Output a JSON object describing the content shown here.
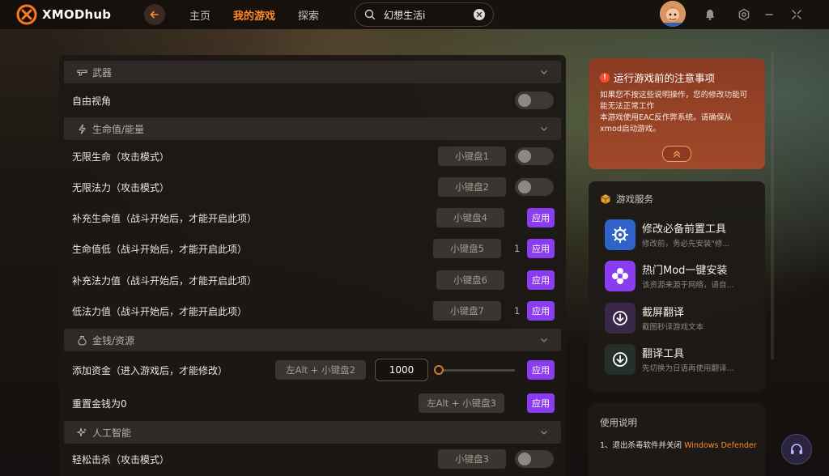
{
  "app": {
    "name": "XMODhub",
    "accent": "#ff8a2a",
    "apply_color": "#8b3cf0"
  },
  "nav": {
    "home": "主页",
    "my_games": "我的游戏",
    "explore": "探索"
  },
  "search": {
    "value": "幻想生活i"
  },
  "sections": {
    "weapon": "武器",
    "health": "生命值/能量",
    "money": "金钱/资源",
    "ai": "人工智能"
  },
  "rows": {
    "free_view": {
      "label": "自由视角"
    },
    "inf_health": {
      "label": "无限生命（攻击模式）",
      "key": "小键盘1"
    },
    "inf_mana": {
      "label": "无限法力（攻击模式）",
      "key": "小键盘2"
    },
    "refill_hp": {
      "label": "补充生命值（战斗开始后，才能开启此项）",
      "key": "小键盘4",
      "apply": "应用"
    },
    "low_hp": {
      "label": "生命值低（战斗开始后，才能开启此项）",
      "key": "小键盘5",
      "num": "1",
      "apply": "应用"
    },
    "refill_mp": {
      "label": "补充法力值（战斗开始后，才能开启此项）",
      "key": "小键盘6",
      "apply": "应用"
    },
    "low_mp": {
      "label": "低法力值（战斗开始后，才能开启此项）",
      "key": "小键盘7",
      "num": "1",
      "apply": "应用"
    },
    "add_money": {
      "label": "添加资金（进入游戏后，才能修改）",
      "key": "左Alt + 小键盘2",
      "value": "1000",
      "slider_fraction": 0.0,
      "apply": "应用"
    },
    "reset_money": {
      "label": "重置金钱为0",
      "key": "左Alt + 小键盘3",
      "apply": "应用"
    },
    "easy_kill": {
      "label": "轻松击杀（攻击模式）",
      "key": "小键盘3"
    }
  },
  "warning": {
    "badge": "!",
    "title": "运行游戏前的注意事项",
    "line1": "如果您不按这些说明操作，您的修改功能可能无法正常工作",
    "line2": "本游戏使用EAC反作弊系统。请确保从xmod启动游戏。"
  },
  "services": {
    "title": "游戏服务",
    "items": [
      {
        "title": "修改必备前置工具",
        "desc": "修改前，务必先安装\"修..."
      },
      {
        "title": "热门Mod一键安装",
        "desc": "该资源来源于网络，请自..."
      },
      {
        "title": "截屏翻译",
        "desc": "截图秒译游戏文本"
      },
      {
        "title": "翻译工具",
        "desc": "先切换为日语再使用翻译..."
      }
    ]
  },
  "usage": {
    "title": "使用说明",
    "step1_a": "1、退出杀毒软件并关闭",
    "step1_b": " Windows Defender"
  }
}
